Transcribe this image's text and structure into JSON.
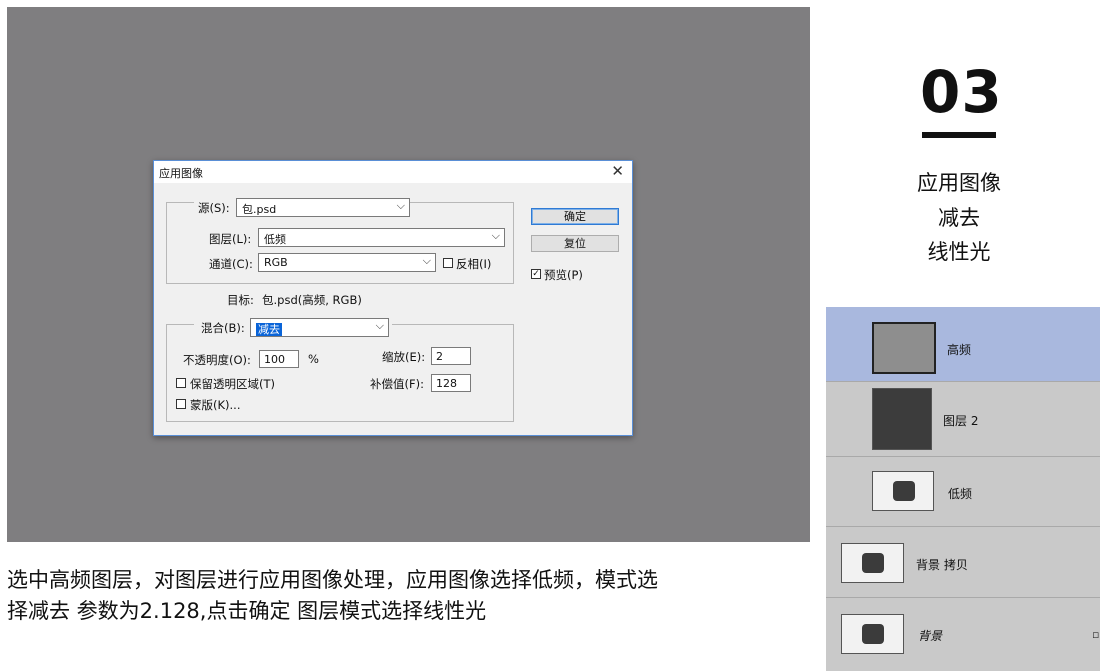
{
  "dialog": {
    "title": "应用图像",
    "close": "✕",
    "source_label": "源(S):",
    "source_value": "包.psd",
    "layer_label": "图层(L):",
    "layer_value": "低频",
    "channel_label": "通道(C):",
    "channel_value": "RGB",
    "invert_label": "反相(I)",
    "target_label": "目标:",
    "target_value": "包.psd(高频, RGB)",
    "blend_label": "混合(B):",
    "blend_value": "减去",
    "opacity_label": "不透明度(O):",
    "opacity_value": "100",
    "opacity_unit": "%",
    "scale_label": "缩放(E):",
    "scale_value": "2",
    "offset_label": "补偿值(F):",
    "offset_value": "128",
    "preserve_label": "保留透明区域(T)",
    "mask_label": "蒙版(K)...",
    "ok_label": "确定",
    "reset_label": "复位",
    "preview_label": "预览(P)",
    "preview_checked": true
  },
  "step": {
    "number": "03",
    "lines": [
      "应用图像",
      "减去",
      "线性光"
    ]
  },
  "layers": [
    {
      "name": "高频",
      "active": true
    },
    {
      "name": "图层 2",
      "active": false
    },
    {
      "name": "低频",
      "active": false
    },
    {
      "name": "背景 拷贝",
      "active": false
    },
    {
      "name": "背景",
      "active": false
    }
  ],
  "caption": {
    "line1": "选中高频图层，对图层进行应用图像处理，应用图像选择低频，模式选",
    "line2": "择减去  参数为2.128,点击确定 图层模式选择线性光"
  }
}
